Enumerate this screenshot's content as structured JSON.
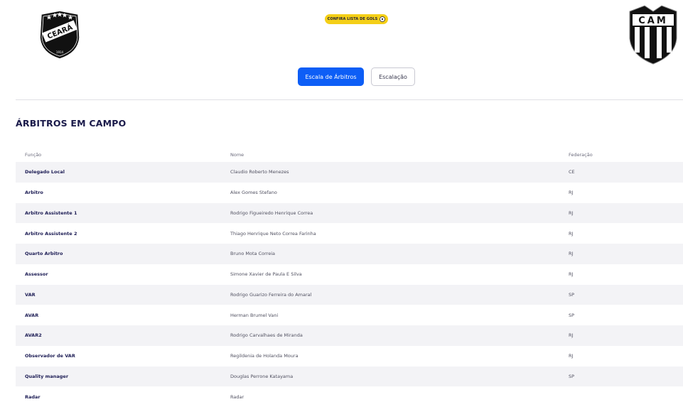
{
  "header": {
    "home_team_logo": "ceara-crest",
    "home_team_logo_text": "CEARÁ",
    "home_team_logo_year": "1914",
    "away_team_logo": "atletico-mineiro-crest",
    "away_team_logo_text": "CAM",
    "confira_label": "CONFIRA LISTA DE GOLS",
    "confira_icon": "soccer-ball-icon"
  },
  "tabs": [
    {
      "label": "Escala de Árbitros",
      "active": true
    },
    {
      "label": "Escalação",
      "active": false
    }
  ],
  "section_title": "ÁRBITROS EM CAMPO",
  "table": {
    "headers": [
      "Função",
      "Nome",
      "Federação"
    ],
    "rows": [
      [
        "Delegado Local",
        "Claudio Roberto Menezes",
        "CE"
      ],
      [
        "Arbitro",
        "Alex Gomes Stefano",
        "RJ"
      ],
      [
        "Arbitro Assistente 1",
        "Rodrigo Figueiredo Henrique Correa",
        "RJ"
      ],
      [
        "Arbitro Assistente 2",
        "Thiago Henrique Neto Correa Farinha",
        "RJ"
      ],
      [
        "Quarto Arbitro",
        "Bruno Mota Correia",
        "RJ"
      ],
      [
        "Assessor",
        "Simone Xavier de Paula E Silva",
        "RJ"
      ],
      [
        "VAR",
        "Rodrigo Guarizo Ferreira do Amaral",
        "SP"
      ],
      [
        "AVAR",
        "Herman Brumel Vani",
        "SP"
      ],
      [
        "AVAR2",
        "Rodrigo Carvalhaes de Miranda",
        "RJ"
      ],
      [
        "Observador de VAR",
        "Regildenia de Holanda Moura",
        "RJ"
      ],
      [
        "Quality manager",
        "Douglas Perrone Katayama",
        "SP"
      ],
      [
        "Radar",
        "Radar",
        ""
      ]
    ]
  },
  "colors": {
    "primary_button": "#0d5ef6",
    "confira_badge": "#f4cf17",
    "title": "#1a1a4a",
    "row_alt": "#f3f3f6"
  }
}
